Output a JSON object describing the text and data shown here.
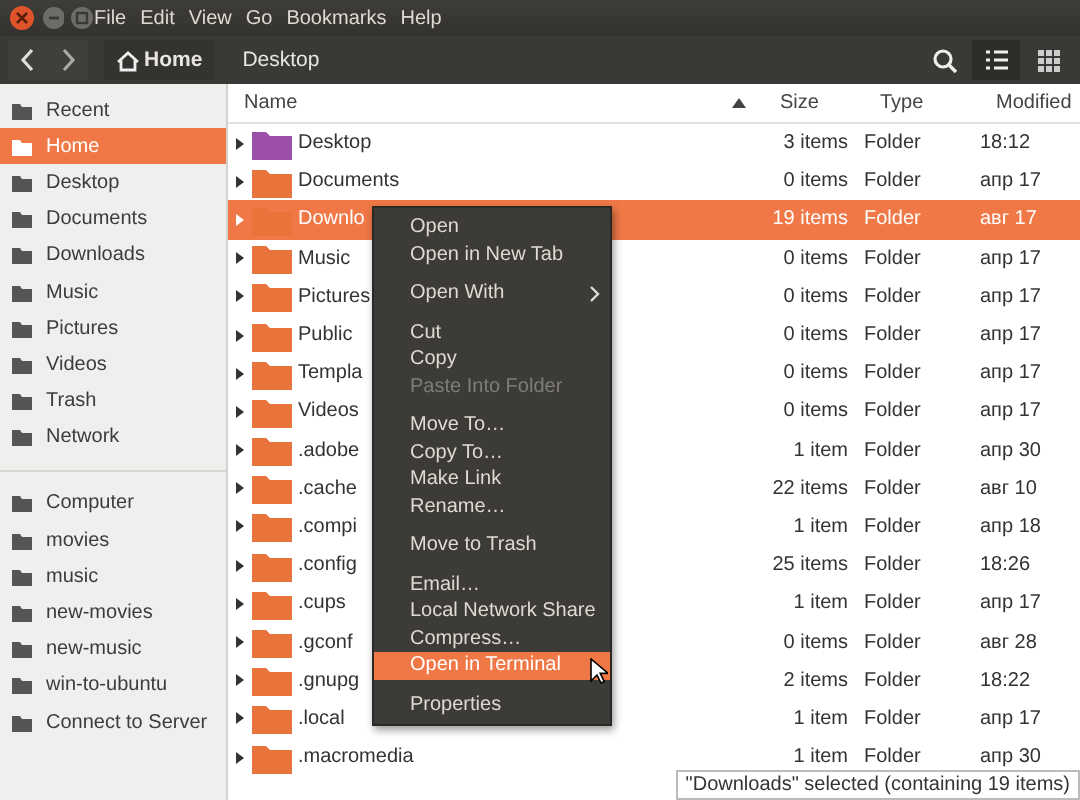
{
  "menubar": [
    "File",
    "Edit",
    "View",
    "Go",
    "Bookmarks",
    "Help"
  ],
  "path": [
    {
      "label": "Home",
      "selected": true
    },
    {
      "label": "Desktop",
      "selected": false
    }
  ],
  "sidebar": {
    "groups": [
      [
        {
          "label": "Recent",
          "selected": false
        },
        {
          "label": "Home",
          "selected": true
        },
        {
          "label": "Desktop",
          "selected": false
        },
        {
          "label": "Documents",
          "selected": false
        },
        {
          "label": "Downloads",
          "selected": false
        },
        {
          "label": "Music",
          "selected": false
        },
        {
          "label": "Pictures",
          "selected": false
        },
        {
          "label": "Videos",
          "selected": false
        },
        {
          "label": "Trash",
          "selected": false
        },
        {
          "label": "Network",
          "selected": false
        }
      ],
      [
        {
          "label": "Computer",
          "selected": false
        },
        {
          "label": "movies",
          "selected": false
        },
        {
          "label": "music",
          "selected": false
        },
        {
          "label": "new-movies",
          "selected": false
        },
        {
          "label": "new-music",
          "selected": false
        },
        {
          "label": "win-to-ubuntu",
          "selected": false
        },
        {
          "label": "Connect to Server",
          "selected": false
        }
      ]
    ]
  },
  "table": {
    "columns": [
      "Name",
      "Size",
      "Type",
      "Modified"
    ],
    "rows": [
      {
        "name": "Desktop",
        "size": "3 items",
        "type": "Folder",
        "modified": "18:12",
        "selected": false,
        "color": "#9b4fa8"
      },
      {
        "name": "Documents",
        "size": "0 items",
        "type": "Folder",
        "modified": "апр 17",
        "selected": false,
        "color": "#e8743b"
      },
      {
        "name": "Downlo",
        "size": "19 items",
        "type": "Folder",
        "modified": "авг 17",
        "selected": true,
        "color": "#e8743b"
      },
      {
        "name": "Music",
        "size": "0 items",
        "type": "Folder",
        "modified": "апр 17",
        "selected": false,
        "color": "#e8743b"
      },
      {
        "name": "Pictures",
        "size": "0 items",
        "type": "Folder",
        "modified": "апр 17",
        "selected": false,
        "color": "#e8743b"
      },
      {
        "name": "Public",
        "size": "0 items",
        "type": "Folder",
        "modified": "апр 17",
        "selected": false,
        "color": "#e8743b"
      },
      {
        "name": "Templa",
        "size": "0 items",
        "type": "Folder",
        "modified": "апр 17",
        "selected": false,
        "color": "#e8743b"
      },
      {
        "name": "Videos",
        "size": "0 items",
        "type": "Folder",
        "modified": "апр 17",
        "selected": false,
        "color": "#e8743b"
      },
      {
        "name": ".adobe",
        "size": "1 item",
        "type": "Folder",
        "modified": "апр 30",
        "selected": false,
        "color": "#e8743b"
      },
      {
        "name": ".cache",
        "size": "22 items",
        "type": "Folder",
        "modified": "авг 10",
        "selected": false,
        "color": "#e8743b"
      },
      {
        "name": ".compi",
        "size": "1 item",
        "type": "Folder",
        "modified": "апр 18",
        "selected": false,
        "color": "#e8743b"
      },
      {
        "name": ".config",
        "size": "25 items",
        "type": "Folder",
        "modified": "18:26",
        "selected": false,
        "color": "#e8743b"
      },
      {
        "name": ".cups",
        "size": "1 item",
        "type": "Folder",
        "modified": "апр 17",
        "selected": false,
        "color": "#e8743b"
      },
      {
        "name": ".gconf",
        "size": "0 items",
        "type": "Folder",
        "modified": "авг 28",
        "selected": false,
        "color": "#e8743b"
      },
      {
        "name": ".gnupg",
        "size": "2 items",
        "type": "Folder",
        "modified": "18:22",
        "selected": false,
        "color": "#e8743b"
      },
      {
        "name": ".local",
        "size": "1 item",
        "type": "Folder",
        "modified": "апр 17",
        "selected": false,
        "color": "#e8743b"
      },
      {
        "name": ".macromedia",
        "size": "1 item",
        "type": "Folder",
        "modified": "апр 30",
        "selected": false,
        "color": "#e8743b"
      }
    ]
  },
  "context_menu": {
    "items": [
      {
        "kind": "item",
        "label": "Open",
        "disabled": false,
        "selected": false
      },
      {
        "kind": "item",
        "label": "Open in New Tab",
        "disabled": false,
        "selected": false
      },
      {
        "kind": "separator"
      },
      {
        "kind": "submenu",
        "label": "Open With",
        "disabled": false,
        "selected": false
      },
      {
        "kind": "separator"
      },
      {
        "kind": "item",
        "label": "Cut",
        "disabled": false,
        "selected": false
      },
      {
        "kind": "item",
        "label": "Copy",
        "disabled": false,
        "selected": false
      },
      {
        "kind": "item",
        "label": "Paste Into Folder",
        "disabled": true,
        "selected": false
      },
      {
        "kind": "separator"
      },
      {
        "kind": "item",
        "label": "Move To…",
        "disabled": false,
        "selected": false
      },
      {
        "kind": "item",
        "label": "Copy To…",
        "disabled": false,
        "selected": false
      },
      {
        "kind": "item",
        "label": "Make Link",
        "disabled": false,
        "selected": false
      },
      {
        "kind": "item",
        "label": "Rename…",
        "disabled": false,
        "selected": false
      },
      {
        "kind": "separator"
      },
      {
        "kind": "item",
        "label": "Move to Trash",
        "disabled": false,
        "selected": false
      },
      {
        "kind": "separator"
      },
      {
        "kind": "item",
        "label": "Email…",
        "disabled": false,
        "selected": false
      },
      {
        "kind": "item",
        "label": "Local Network Share",
        "disabled": false,
        "selected": false
      },
      {
        "kind": "item",
        "label": "Compress…",
        "disabled": false,
        "selected": false
      },
      {
        "kind": "item",
        "label": "Open in Terminal",
        "disabled": false,
        "selected": true
      },
      {
        "kind": "separator"
      },
      {
        "kind": "item",
        "label": "Properties",
        "disabled": false,
        "selected": false
      }
    ]
  },
  "status_bar": "\"Downloads\" selected  (containing 19 items)"
}
